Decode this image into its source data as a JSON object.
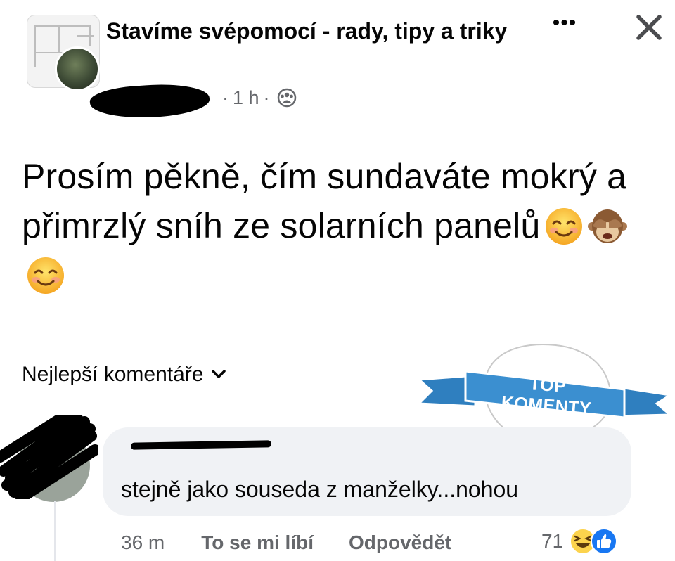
{
  "post": {
    "group_name": "Stavíme svépomocí - rady, tipy a triky",
    "time": "1 h",
    "separator": "·",
    "text": "Prosím pěkně, čím sundaváte mokrý a přimrzlý sníh ze solarních panelů"
  },
  "header": {
    "more_label": "•••",
    "close_icon": "close-icon",
    "audience_icon": "group-members-icon"
  },
  "comments_filter": {
    "label": "Nejlepší komentáře",
    "icon": "chevron-down-icon"
  },
  "badge": {
    "text": "TOP KOMENTY",
    "color": "#2f7fbf"
  },
  "comment": {
    "text": "stejně jako souseda z manželky...nohou",
    "time": "36 m",
    "like_label": "To se mi líbí",
    "reply_label": "Odpovědět",
    "reaction_count": "71",
    "reactions": [
      "haha-icon",
      "like-reaction-icon"
    ]
  },
  "colors": {
    "secondary_text": "#65676b",
    "bubble_bg": "#f0f2f5",
    "like_blue": "#1877f2"
  }
}
